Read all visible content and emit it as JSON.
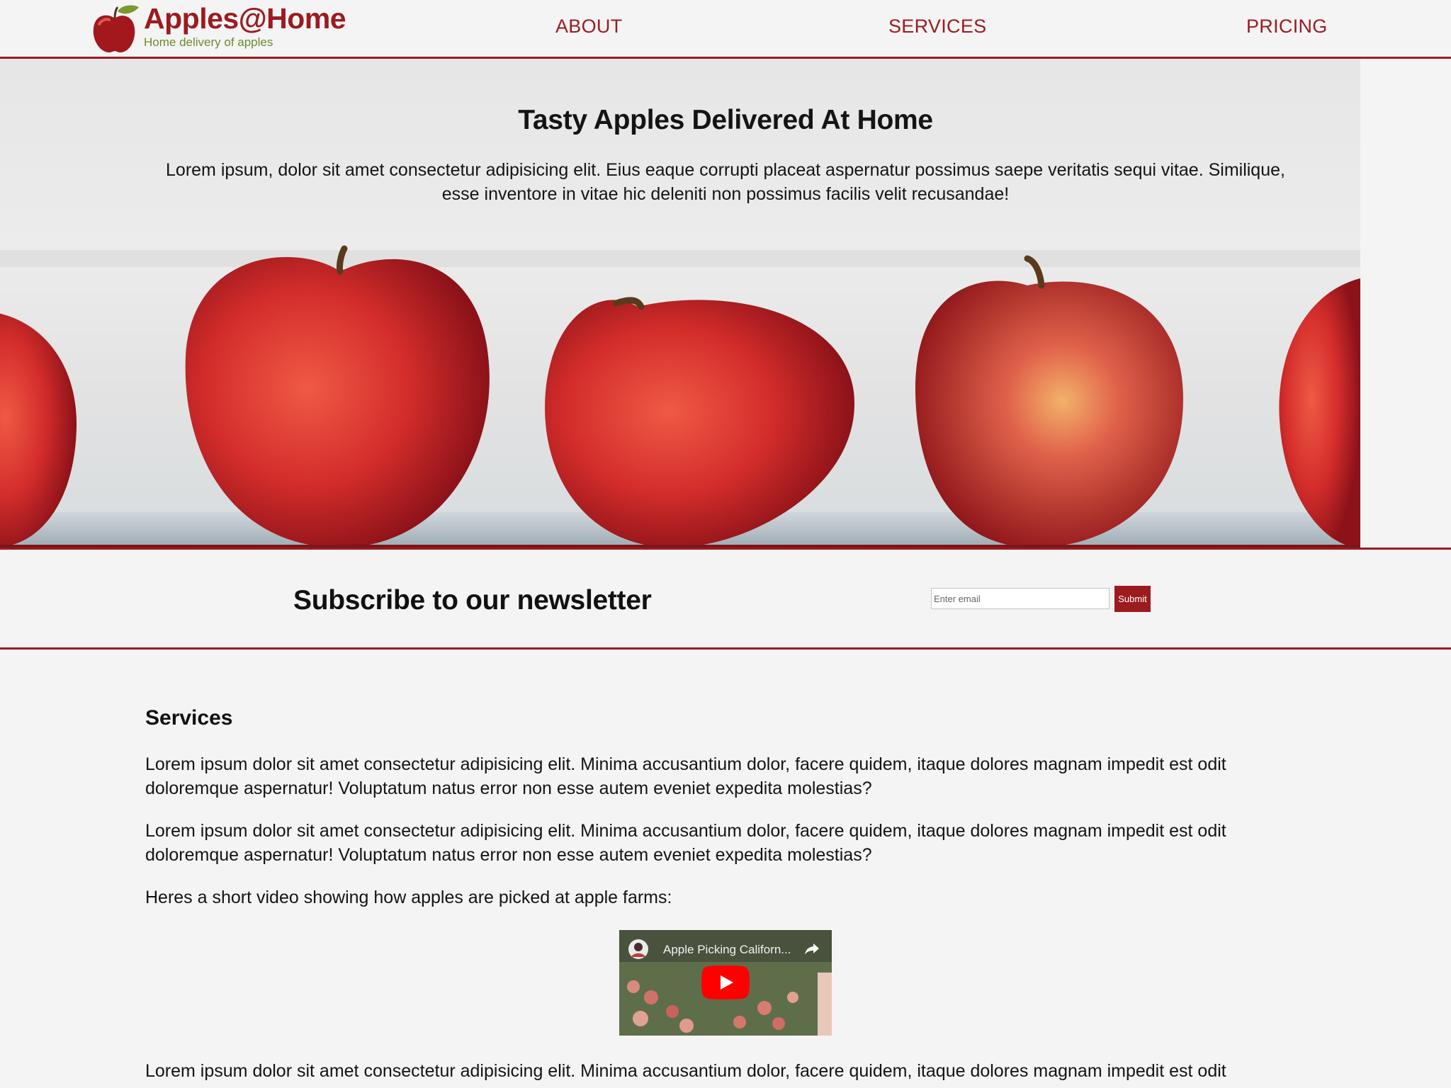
{
  "header": {
    "brand_name": "Apples@Home",
    "brand_tagline": "Home delivery of apples",
    "nav": [
      {
        "label": "ABOUT"
      },
      {
        "label": "SERVICES"
      },
      {
        "label": "PRICING"
      }
    ]
  },
  "hero": {
    "title": "Tasty Apples Delivered At Home",
    "text": "Lorem ipsum, dolor sit amet consectetur adipisicing elit. Eius eaque corrupti placeat aspernatur possimus saepe veritatis sequi vitae. Similique, esse inventore in vitae hic deleniti non possimus facilis velit recusandae!"
  },
  "newsletter": {
    "title": "Subscribe to our newsletter",
    "email_placeholder": "Enter email",
    "submit_label": "Submit"
  },
  "services": {
    "title": "Services",
    "paragraphs": [
      "Lorem ipsum dolor sit amet consectetur adipisicing elit. Minima accusantium dolor, facere quidem, itaque dolores magnam impedit est odit doloremque aspernatur! Voluptatum natus error non esse autem eveniet expedita molestias?",
      "Lorem ipsum dolor sit amet consectetur adipisicing elit. Minima accusantium dolor, facere quidem, itaque dolores magnam impedit est odit doloremque aspernatur! Voluptatum natus error non esse autem eveniet expedita molestias?",
      "Heres a short video showing how apples are picked at apple farms:",
      "Lorem ipsum dolor sit amet consectetur adipisicing elit. Minima accusantium dolor, facere quidem, itaque dolores magnam impedit est odit"
    ],
    "video": {
      "title": "Apple Picking Californ..."
    }
  },
  "colors": {
    "brand_red": "#9b1b1f",
    "tagline_green": "#6f8a2c",
    "background": "#f4f4f4"
  }
}
